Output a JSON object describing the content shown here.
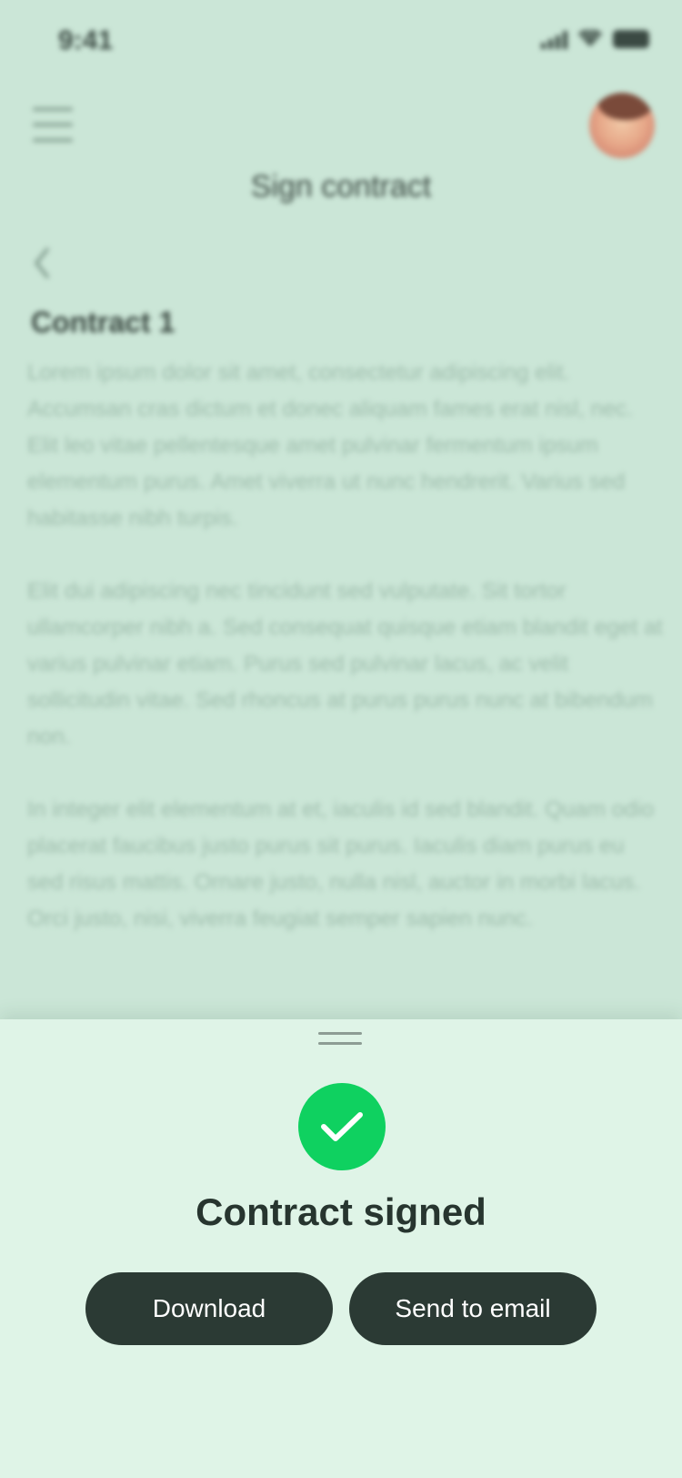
{
  "status_bar": {
    "time": "9:41"
  },
  "header": {
    "title": "Sign contract",
    "avatar_icon": "user-avatar"
  },
  "document": {
    "title": "Contract 1",
    "paragraphs": [
      "Lorem ipsum dolor sit amet, consectetur adipiscing elit. Accumsan cras dictum et donec aliquam fames erat nisl, nec. Elit leo vitae pellentesque amet pulvinar fermentum ipsum elementum purus. Amet viverra ut nunc hendrerit. Varius sed habitasse nibh turpis.",
      "Elit dui adipiscing nec tincidunt sed vulputate. Sit tortor ullamcorper nibh a. Sed consequat quisque etiam blandit eget at varius pulvinar etiam. Purus sed pulvinar lacus, ac velit sollicitudin vitae. Sed rhoncus at purus purus nunc at bibendum non.",
      "In integer elit elementum at et, iaculis id sed blandit. Quam odio placerat faucibus justo purus sit purus. Iaculis diam purus eu sed risus mattis. Ornare justo, nulla nisl, auctor in morbi lacus. Orci justo, nisi, viverra feugiat semper sapien nunc."
    ]
  },
  "sheet": {
    "title": "Contract signed",
    "success_icon": "check-icon",
    "buttons": {
      "download": "Download",
      "send_email": "Send to email"
    }
  },
  "colors": {
    "background_overlay": "#cbe6d7",
    "sheet_background": "#dff4e7",
    "success_green": "#0fd160",
    "button_dark": "#2b3a34"
  }
}
